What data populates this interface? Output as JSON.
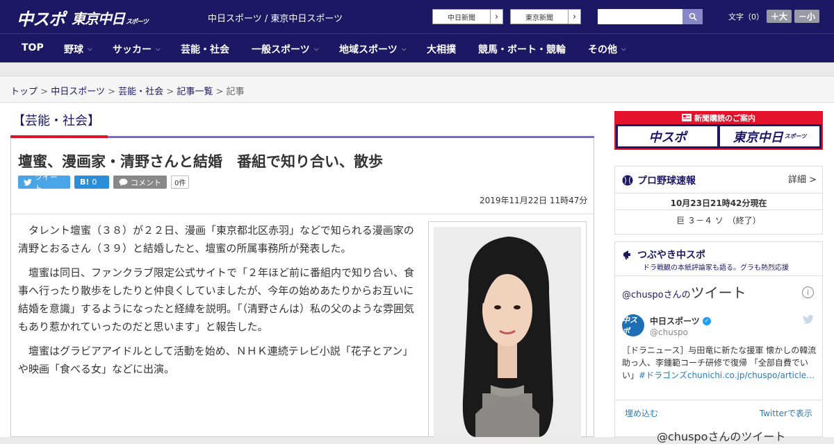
{
  "header": {
    "logo_main": "中スポ",
    "logo_tokyo": "東京中日",
    "logo_tokyo_sub": "スポーツ",
    "site_links": "中日スポーツ / 東京中日スポーツ",
    "site_buttons": [
      {
        "label": "中日新聞",
        "arrow": "›"
      },
      {
        "label": "東京新聞",
        "arrow": "›"
      }
    ],
    "search_placeholder": "",
    "font_size_label": "文字（0）",
    "font_plus": "＋大",
    "font_minus": "－小"
  },
  "nav": {
    "items": [
      {
        "label": "TOP",
        "chev": ""
      },
      {
        "label": "野球",
        "chev": "⌵"
      },
      {
        "label": "サッカー",
        "chev": "⌵"
      },
      {
        "label": "芸能・社会",
        "chev": ""
      },
      {
        "label": "一般スポーツ",
        "chev": "⌵"
      },
      {
        "label": "地域スポーツ",
        "chev": "⌵"
      },
      {
        "label": "大相撲",
        "chev": ""
      },
      {
        "label": "競馬・ボート・競輪",
        "chev": ""
      },
      {
        "label": "その他",
        "chev": "⌵"
      }
    ]
  },
  "breadcrumb": {
    "items": [
      "トップ",
      "中日スポーツ",
      "芸能・社会",
      "記事一覧"
    ],
    "current": "記事",
    "separator": ">"
  },
  "article": {
    "category": "【芸能・社会】",
    "headline": "壇蜜、漫画家・清野さんと結婚　番組で知り合い、散歩",
    "share": {
      "tweet": "ツイート",
      "hatena": "B!",
      "hatena_count": "0",
      "comment": "コメント",
      "comment_count": "0件"
    },
    "date": "2019年11月22日 11時47分",
    "paragraphs": [
      "タレント壇蜜（３８）が２２日、漫画「東京都北区赤羽」などで知られる漫画家の清野とおるさん（３９）と結婚したと、壇蜜の所属事務所が発表した。",
      "壇蜜は同日、ファンクラブ限定公式サイトで「２年ほど前に番組内で知り合い、食事へ行ったり散歩をしたりと仲良くしていましたが、今年の始めあたりからお互いに結婚を意識」するようになったと経緯を説明。「（清野さんは）私の父のような雰囲気もあり惹かれていったのだと思います」と報告した。",
      "壇蜜はグラビアアイドルとして活動を始め、ＮＨＫ連続テレビ小説「花子とアン」や映画「食べる女」などに出演。"
    ]
  },
  "sidebar": {
    "ad": {
      "header": "新聞購読のご案内",
      "logo1": "中スポ",
      "logo2": "東京中日",
      "logo2_sub": "スポーツ"
    },
    "baseball": {
      "title": "プロ野球速報",
      "detail": "詳細 >",
      "time": "10月23日21時42分現在",
      "score": "巨 ３－４ ソ　（終了）"
    },
    "twitter": {
      "title": "つぶやき中スポ",
      "subtitle": "ドラ戦観の本紙評論家も語る。グラも熱烈応援",
      "handle_prefix": "@chuspoさんの",
      "handle_big": "ツイート",
      "info": "i",
      "avatar": "中スポ",
      "name": "中日スポーツ",
      "verified": "✓",
      "at": "@chuspo",
      "tweet_text": "［ドラニュース］与田竜に新たな援軍 懐かしの韓流助っ人、李鍾範コーチ研修で復帰 「全部自費でいい」",
      "tweet_hash": "#ドラゴンズ",
      "tweet_link": "chunichi.co.jp/chuspo/article…",
      "embed": "埋め込む",
      "view": "Twitterで表示",
      "bottom": "@chuspoさんのツイート"
    }
  },
  "colors": {
    "navy": "#1d1864",
    "red": "#e4122a",
    "link_blue": "#2b7bb9"
  }
}
